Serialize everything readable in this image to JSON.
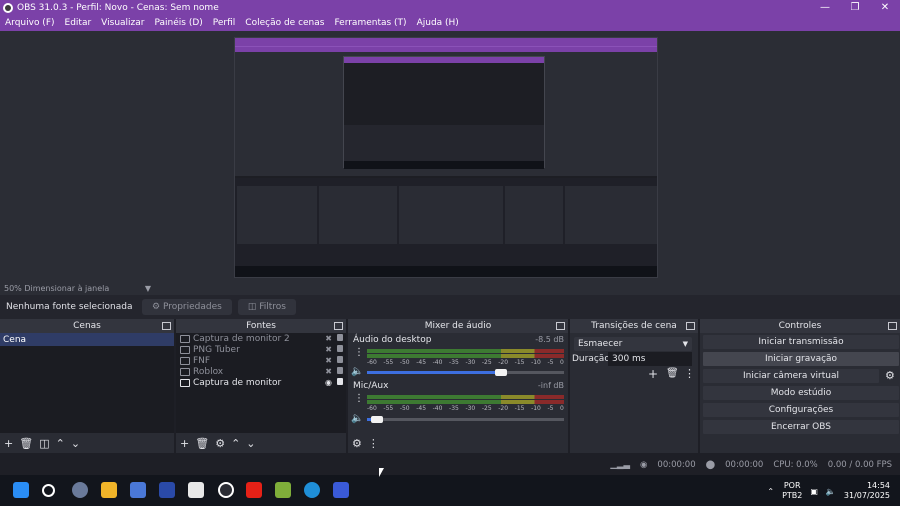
{
  "window": {
    "title": "OBS 31.0.3 - Perfil: Novo - Cenas: Sem nome"
  },
  "menu": [
    "Arquivo (F)",
    "Editar",
    "Visualizar",
    "Painéis (D)",
    "Perfil",
    "Coleção de cenas",
    "Ferramentas (T)",
    "Ajuda (H)"
  ],
  "preview": {
    "zoom": "50%",
    "zoom_label": "Dimensionar à janela"
  },
  "source_bar": {
    "no_source": "Nenhuma fonte selecionada",
    "properties": "Propriedades",
    "filters": "Filtros"
  },
  "panels": {
    "scenes": {
      "title": "Cenas",
      "items": [
        "Cena"
      ]
    },
    "sources": {
      "title": "Fontes",
      "items": [
        "Captura de monitor 2",
        "PNG Tuber",
        "FNF",
        "Roblox",
        "Captura de monitor"
      ]
    },
    "mixer": {
      "title": "Mixer de áudio",
      "channels": [
        {
          "name": "Áudio do desktop",
          "db": "-8.5 dB"
        },
        {
          "name": "Mic/Aux",
          "db": "-inf dB"
        }
      ],
      "scale": [
        "-60",
        "-55",
        "-50",
        "-45",
        "-40",
        "-35",
        "-30",
        "-25",
        "-20",
        "-15",
        "-10",
        "-5",
        "0"
      ],
      "desktop_volume": 0.68,
      "mic_volume": 0.05
    },
    "transitions": {
      "title": "Transições de cena",
      "selected": "Esmaecer",
      "duration_label": "Duração",
      "duration_value": "300 ms"
    },
    "controls": {
      "title": "Controles",
      "buttons": [
        "Iniciar transmissão",
        "Iniciar gravação",
        "Iniciar câmera virtual",
        "Modo estúdio",
        "Configurações",
        "Encerrar OBS"
      ]
    }
  },
  "status": {
    "stream_time": "00:00:00",
    "rec_time": "00:00:00",
    "cpu": "CPU: 0.0%",
    "fps": "0.00 / 0.00 FPS"
  },
  "taskbar": {
    "lang_top": "POR",
    "lang_bottom": "PTB2",
    "time": "14:54",
    "date": "31/07/2025"
  },
  "colors": {
    "accent": "#7b41a8",
    "selected_scene": "#2f3c66",
    "panel_bg": "#2a2c34"
  }
}
